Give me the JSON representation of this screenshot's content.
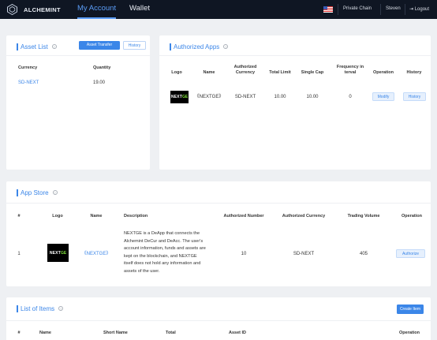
{
  "topbar": {
    "brand": "Alchemint",
    "tabs": [
      "My Account",
      "Wallet"
    ],
    "chain": "Private Chain",
    "user": "Steven",
    "logout": "Logout"
  },
  "asset_list": {
    "title": "Asset List",
    "transfer_button": "Asset Transfer",
    "history_button": "History",
    "columns": [
      "Currency",
      "Quantity"
    ],
    "rows": [
      {
        "currency": "SD-NEXT",
        "quantity": "19.00"
      }
    ]
  },
  "authorized_apps": {
    "title": "Authorized Apps",
    "columns": [
      "Logo",
      "Name",
      "Authorized Currency",
      "Total Limit",
      "Single Cap",
      "Frequency in terval",
      "Operation",
      "History"
    ],
    "rows": [
      {
        "logo_text": "NEXT",
        "logo_accent": "GE",
        "name": "《NEXTGE》",
        "currency": "SD-NEXT",
        "total_limit": "10.00",
        "single_cap": "10.00",
        "frequency": "0",
        "operation": "Modify",
        "history": "History"
      }
    ]
  },
  "app_store": {
    "title": "App Store",
    "columns": [
      "#",
      "Logo",
      "Name",
      "Description",
      "Authorized Number",
      "Authorized Currency",
      "Trading Volume",
      "Operation"
    ],
    "rows": [
      {
        "index": "1",
        "logo_text": "NEXT",
        "logo_accent": "GE",
        "name": "《NEXTGE》",
        "description": "NEXTGE is a DeApp that connects the Alchemint DeCur and DeAcc. The user's account information, funds and assets are kept on the blockchain, and NEXTGE itself does not hold any information and assets of the user.",
        "authorized_number": "10",
        "currency": "SD-NEXT",
        "trading_volume": "405",
        "operation": "Authorize"
      }
    ]
  },
  "items": {
    "title": "List of Items",
    "create_button": "Create Item",
    "columns": [
      "#",
      "Name",
      "Short Name",
      "Total",
      "Asset ID",
      "Operation"
    ]
  },
  "colors": {
    "accent": "#3b86e8",
    "topbar": "#0f1623",
    "background": "#eef0f3"
  }
}
